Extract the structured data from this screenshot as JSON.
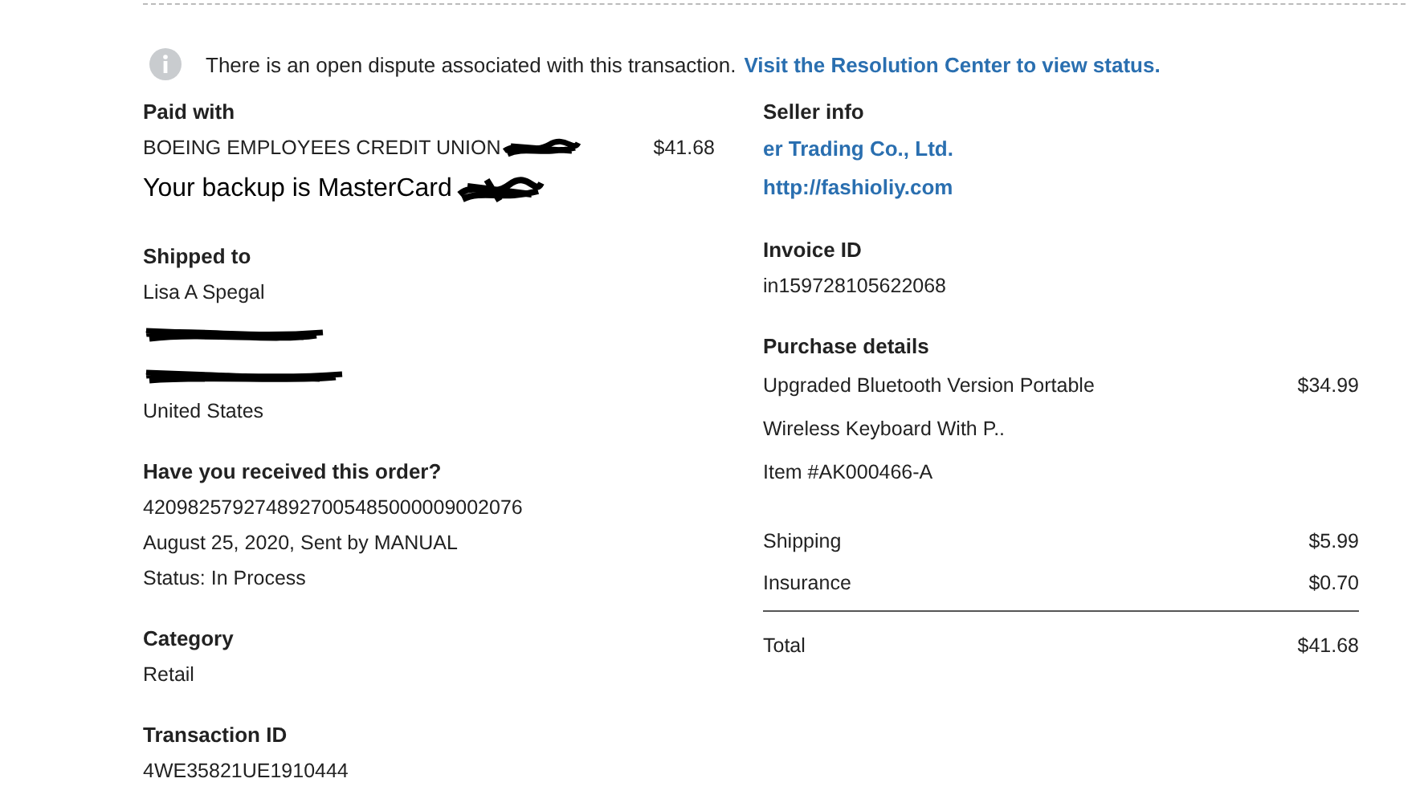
{
  "notice": {
    "text": "There is an open dispute associated with this transaction.",
    "link": "Visit the Resolution Center to view status."
  },
  "paid_with": {
    "heading": "Paid with",
    "source": "BOEING EMPLOYEES CREDIT UNION",
    "amount": "$41.68",
    "backup": "Your backup is MasterCard"
  },
  "shipped_to": {
    "heading": "Shipped to",
    "name": "Lisa A Spegal",
    "country": "United States"
  },
  "order": {
    "heading": "Have you received this order?",
    "lines": [
      "42098257927489270054850000090020​76",
      "August 25, 2020, Sent by MANUAL",
      "Status: In Process"
    ]
  },
  "category": {
    "heading": "Category",
    "value": "Retail"
  },
  "transaction": {
    "heading": "Transaction ID",
    "value": "4WE35821UE1910444"
  },
  "seller_info": {
    "heading": "Seller info",
    "name": "er Trading Co., Ltd.",
    "website": "http://fashioliy.com"
  },
  "invoice": {
    "heading": "Invoice ID",
    "value": "in159728105622068"
  },
  "purchase": {
    "heading": "Purchase details",
    "item_lines": [
      "Upgraded Bluetooth Version Portable",
      "Wireless Keyboard With P.."
    ],
    "price": "$34.99",
    "item_number": "Item #AK000466-A",
    "fees": [
      {
        "label": "Shipping",
        "amount": "$5.99"
      },
      {
        "label": "Insurance",
        "amount": "$0.70"
      }
    ],
    "total": {
      "label": "Total",
      "amount": "$41.68"
    }
  }
}
